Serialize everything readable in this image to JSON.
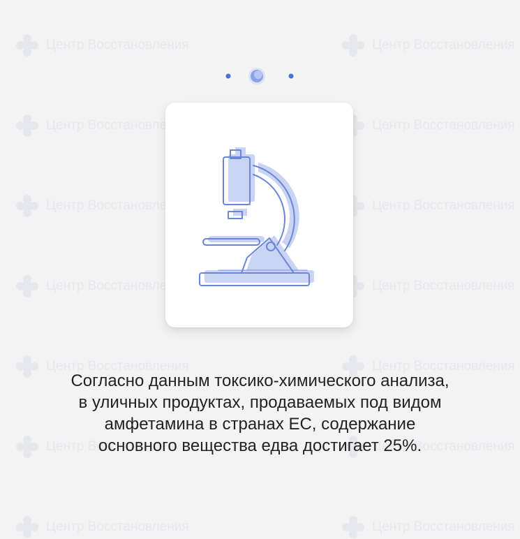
{
  "watermark": {
    "label": "Центр Восстановления"
  },
  "caption": {
    "lines": [
      "Согласно данным токсико-химического анализа,",
      "в уличных продуктах, продаваемых под видом",
      "амфетамина в странах ЕС, содержание",
      "основного вещества едва достигает 25%."
    ]
  },
  "carousel": {
    "slide_count": 3,
    "active_index": 1
  },
  "colors": {
    "accent_fill": "#c9d4f4",
    "accent_stroke": "#6b86d6",
    "dot": "#4a6fd8"
  },
  "icons": {
    "illustration": "microscope-icon"
  }
}
